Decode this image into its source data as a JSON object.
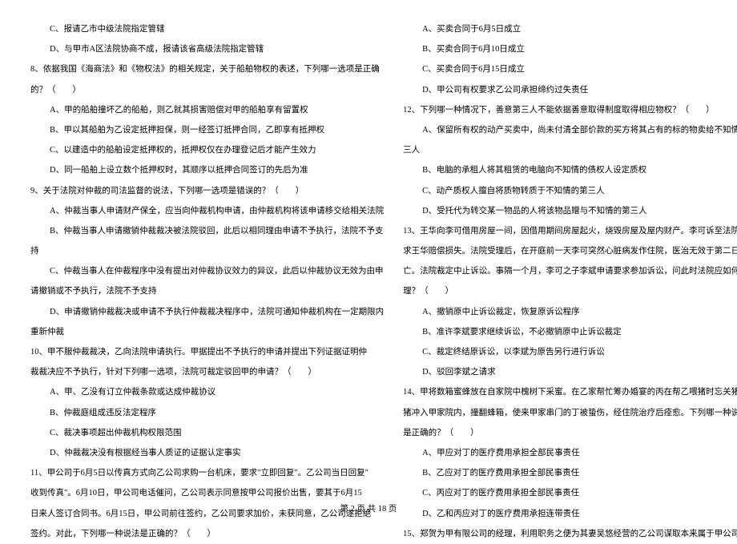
{
  "left": {
    "l1": "C、报请乙市中级法院指定管辖",
    "l2": "D、与甲市A区法院协商不成，报请该省高级法院指定管辖",
    "l3": "8、依据我国《海商法》和《物权法》的相关规定，关于船舶物权的表述，下列哪一选项是正确",
    "l4": "的？（　　）",
    "l5": "A、甲的船舶撞坏乙的船舶，则乙就其损害赔偿对甲的船舶享有留置权",
    "l6": "B、甲以其船舶为乙设定抵押担保，则一经签订抵押合同，乙即享有抵押权",
    "l7": "C、以建造中的船舶设定抵押权的，抵押权仅在办理登记后才能产生效力",
    "l8": "D、同一船舶上设立数个抵押权时，其顺序以抵押合同签订的先后为准",
    "l9": "9、关于法院对仲裁的司法监督的说法，下列哪一选项是错误的？（　　）",
    "l10": "A、仲裁当事人申请财产保全，应当向仲裁机构申请，由仲裁机构将该申请移交给相关法院",
    "l11": "B、仲裁当事人申请撤销仲裁裁决被法院驳回，此后以相同理由申请不予执行，法院不予支",
    "l12": "持",
    "l13": "C、仲裁当事人在仲裁程序中没有提出对仲裁协议效力的异议，此后以仲裁协议无效为由申",
    "l14": "请撤销或不予执行，法院不予支持",
    "l15": "D、申请撤销仲裁裁决或申请不予执行仲裁裁决程序中，法院可通知仲裁机构在一定期限内",
    "l16": "重新仲裁",
    "l17": "10、甲不服仲裁裁决，乙向法院申请执行。甲据提出不予执行的申请并提出下列证据证明仲",
    "l18": "裁裁决应不予执行，针对下列哪一选项，法院可裁定驳回甲的申请？（　　）",
    "l19": "A、甲、乙没有订立仲裁条款或达成仲裁协议",
    "l20": "B、仲裁庭组成违反法定程序",
    "l21": "C、裁决事项超出仲裁机构权限范围",
    "l22": "D、仲裁裁决没有根据经当事人质证的证据认定事实",
    "l23": "11、甲公司于6月5日以传真方式向乙公司求购一台机床，要求\"立即回复\"。乙公司当日回复\"",
    "l24": "收到传真\"。6月10日，甲公司电话催问，乙公司表示同意按甲公司报价出售，要其于6月15",
    "l25": "日来人签订合同书。6月15日，甲公司前往签约，乙公司要求加价，未获同意，乙公司遂拒绝",
    "l26": "签约。对此，下列哪一种说法是正确的？（　　）"
  },
  "right": {
    "r1": "A、买卖合同于6月5日成立",
    "r2": "B、买卖合同于6月10日成立",
    "r3": "C、买卖合同于6月15日成立",
    "r4": "D、甲公司有权要求乙公司承担缔约过失责任",
    "r5": "12、下列哪一种情况下，善意第三人不能依据善意取得制度取得相应物权？（　　）",
    "r6": "A、保留所有权的动产买卖中，尚未付清全部价款的买方将其占有的标的物卖给不知情的第",
    "r7": "三人",
    "r8": "B、电脑的承租人将其租赁的电脑向不知情的债权人设定质权",
    "r9": "C、动产质权人擅自将质物转质于不知情的第三人",
    "r10": "D、受托代为转交某一物品的人将该物品赠与不知情的第三人",
    "r11": "13、王华向李可借用房屋一间，因借用期间房屋起火，烧毁房屋及屋内财产。李可诉至法院要",
    "r12": "求王华赔偿损失。法院受理后，在开庭前一天李可突然心脏病发作住院，医治无效于第二日死",
    "r13": "亡。法院裁定中止诉讼。事隔一个月，李可之子李斌申请要求参加诉讼，问此时法院应如何处",
    "r14": "理？（　　）",
    "r15": "A、撤销原中止诉讼裁定，恢复原诉讼程序",
    "r16": "B、准许李斌要求继续诉讼，不必撤销原中止诉讼裁定",
    "r17": "C、裁定终结原诉讼，以李斌为原告另行进行诉讼",
    "r18": "D、驳回李斌之请求",
    "r19": "14、甲将数箱蜜蜂放在自家院中槐树下采蜜。在乙家帮忙筹办婚宴的丙在帮乙喂猪时忘关猪圈，",
    "r20": "猪冲入甲家院内，撞翻蜂箱，使来甲家串门的丁被蛰伤，经住院治疗后痊愈。下列哪一种说法",
    "r21": "是正确的？（　　）",
    "r22": "A、甲应对丁的医疗费用承担全部民事责任",
    "r23": "B、乙应对丁的医疗费用承担全部民事责任",
    "r24": "C、丙应对丁的医疗费用承担全部民事责任",
    "r25": "D、乙和丙应对丁的医疗费用承担连带责任",
    "r26": "15、郑贺为甲有限公司的经理，利用职务之便为其妻吴悠经营的乙公司谋取本来属于甲公司的"
  },
  "footer": "第 2 页 共 18 页"
}
